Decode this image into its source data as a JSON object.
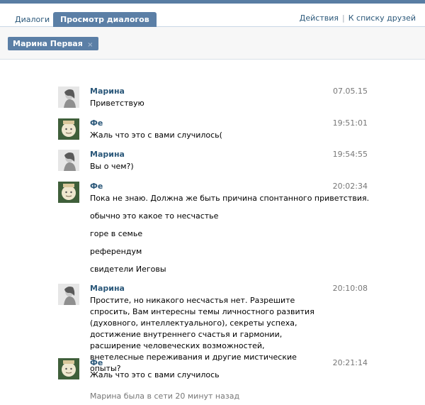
{
  "tabs": [
    {
      "label": "Диалоги",
      "active": false
    },
    {
      "label": "Просмотр диалогов",
      "active": true
    }
  ],
  "top_links": {
    "actions": "Действия",
    "separator": "|",
    "friends": "К списку друзей"
  },
  "peer_chip": {
    "name": "Марина Первая",
    "close_icon": "×"
  },
  "messages": [
    {
      "author": "Марина",
      "time": "07.05.15",
      "avatar": "marina",
      "lines": [
        "Приветствую"
      ]
    },
    {
      "author": "Фе",
      "time": "19:51:01",
      "avatar": "fe",
      "lines": [
        "Жаль что это с вами случилось("
      ]
    },
    {
      "author": "Марина",
      "time": "19:54:55",
      "avatar": "marina",
      "lines": [
        "Вы о чем?)"
      ]
    },
    {
      "author": "Фе",
      "time": "20:02:34",
      "avatar": "fe",
      "lines": [
        "Пока не знаю. Должна же быть причина спонтанного приветствия.",
        "обычно это какое то несчастье",
        "горе в семье",
        "референдум",
        "свидетели Иеговы"
      ]
    },
    {
      "author": "Марина",
      "time": "20:10:08",
      "avatar": "marina",
      "lines": [
        "Простите, но никакого несчастья нет. Разрешите спросить, Вам интересны темы личностного развития (духовного, интеллектуального), секреты успеха, достижение внутреннего счастья и гармонии, расширение человеческих возможностей, внетелесные переживания и другие мистические опыты?"
      ]
    },
    {
      "author": "Фе",
      "time": "20:21:14",
      "avatar": "fe",
      "lines": [
        "Жаль что это с вами случилось"
      ]
    }
  ],
  "online_status": "Марина была в сети 20 минут назад",
  "colors": {
    "accent": "#5b7fa6",
    "link": "#2b587a",
    "muted": "#777777",
    "border": "#c9d7e6"
  }
}
